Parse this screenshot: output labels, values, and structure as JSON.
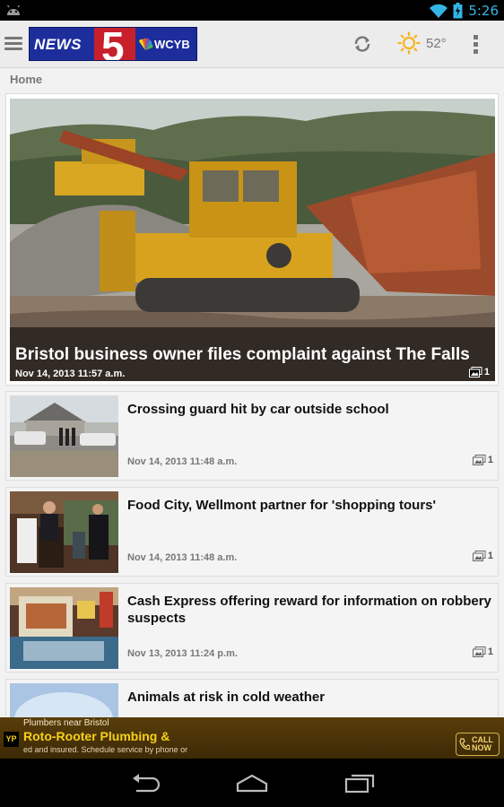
{
  "status_bar": {
    "time": "5:26",
    "icons": [
      "android-icon",
      "wifi-icon",
      "battery-charging-icon"
    ]
  },
  "action_bar": {
    "logo": {
      "news_text": "NEWS",
      "channel_number": "5",
      "station": "WCYB"
    },
    "weather": {
      "temperature": "52°",
      "condition_icon": "sun-icon"
    },
    "icons": [
      "menu-icon",
      "refresh-icon",
      "overflow-icon"
    ]
  },
  "breadcrumb": "Home",
  "featured": {
    "title": "Bristol business owner files complaint against The Falls",
    "date": "Nov 14, 2013 11:57 a.m.",
    "photo_count": "1"
  },
  "articles": [
    {
      "title": "Crossing guard hit by car outside school",
      "date": "Nov 14, 2013 11:48 a.m.",
      "photo_count": "1"
    },
    {
      "title": "Food City, Wellmont partner for 'shopping tours'",
      "date": "Nov 14, 2013 11:48 a.m.",
      "photo_count": "1"
    },
    {
      "title": "Cash Express offering reward for information on robbery suspects",
      "date": "Nov 13, 2013 11:24 p.m.",
      "photo_count": "1"
    },
    {
      "title": "Animals at risk in cold weather",
      "date": "",
      "photo_count": ""
    }
  ],
  "ad": {
    "subtitle": "Plumbers near Bristol",
    "headline": "Roto-Rooter Plumbing &",
    "description": "ed and insured. Schedule service by phone or",
    "badge": "YP",
    "call_line1": "CALL",
    "call_line2": "NOW"
  },
  "nav_bar": {
    "icons": [
      "back-icon",
      "home-icon",
      "recent-apps-icon"
    ]
  }
}
